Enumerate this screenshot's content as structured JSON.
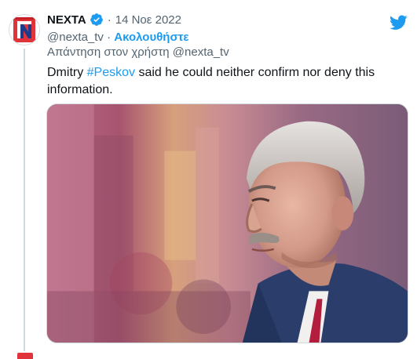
{
  "tweet": {
    "display_name": "NEXTA",
    "verified_icon": "verified-badge-icon",
    "separator": "·",
    "date": "14 Νοε 2022",
    "handle": "@nexta_tv",
    "handle_separator": " · ",
    "follow_label": "Ακολουθήστε",
    "reply_prefix": "Απάντηση στον χρήστη ",
    "reply_handle": "@nexta_tv",
    "text_before": "Dmitry ",
    "hashtag": "#Peskov",
    "text_after": " said he could neither confirm nor deny this information."
  },
  "icons": {
    "avatar": "nexta-logo-avatar",
    "platform": "twitter-bird-icon"
  },
  "colors": {
    "accent_blue": "#1d9bf0",
    "secondary_text": "#536471",
    "primary_text": "#0f1419",
    "brand_red": "#e0333a"
  }
}
